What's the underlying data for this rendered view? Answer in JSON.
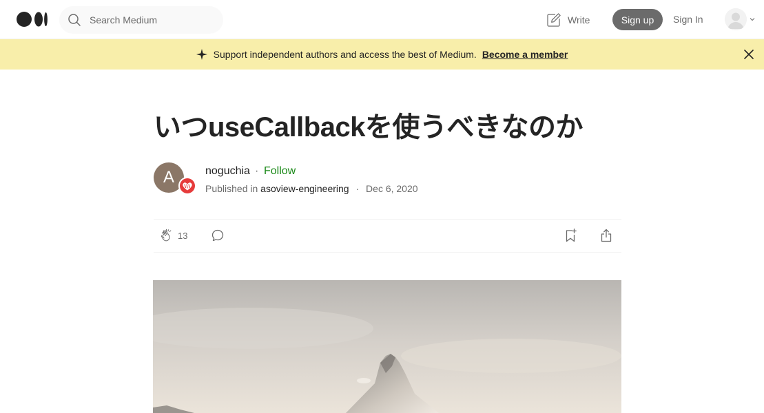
{
  "nav": {
    "search_placeholder": "Search Medium",
    "write_label": "Write",
    "signup_label": "Sign up",
    "signin_label": "Sign In"
  },
  "banner": {
    "text": "Support independent authors and access the best of Medium.",
    "cta": "Become a member"
  },
  "article": {
    "title": "いつuseCallbackを使うべきなのか",
    "author_initial": "A",
    "author_name": "noguchia",
    "dot": "·",
    "follow_label": "Follow",
    "published_in_label": "Published in",
    "publication": "asoview-engineering",
    "date": "Dec 6, 2020",
    "clap_count": "13"
  },
  "colors": {
    "accent_green": "#1a8917",
    "banner_bg": "#f8eeaa",
    "button_gray": "#6b6b6b",
    "badge_red": "#e63b3b"
  }
}
